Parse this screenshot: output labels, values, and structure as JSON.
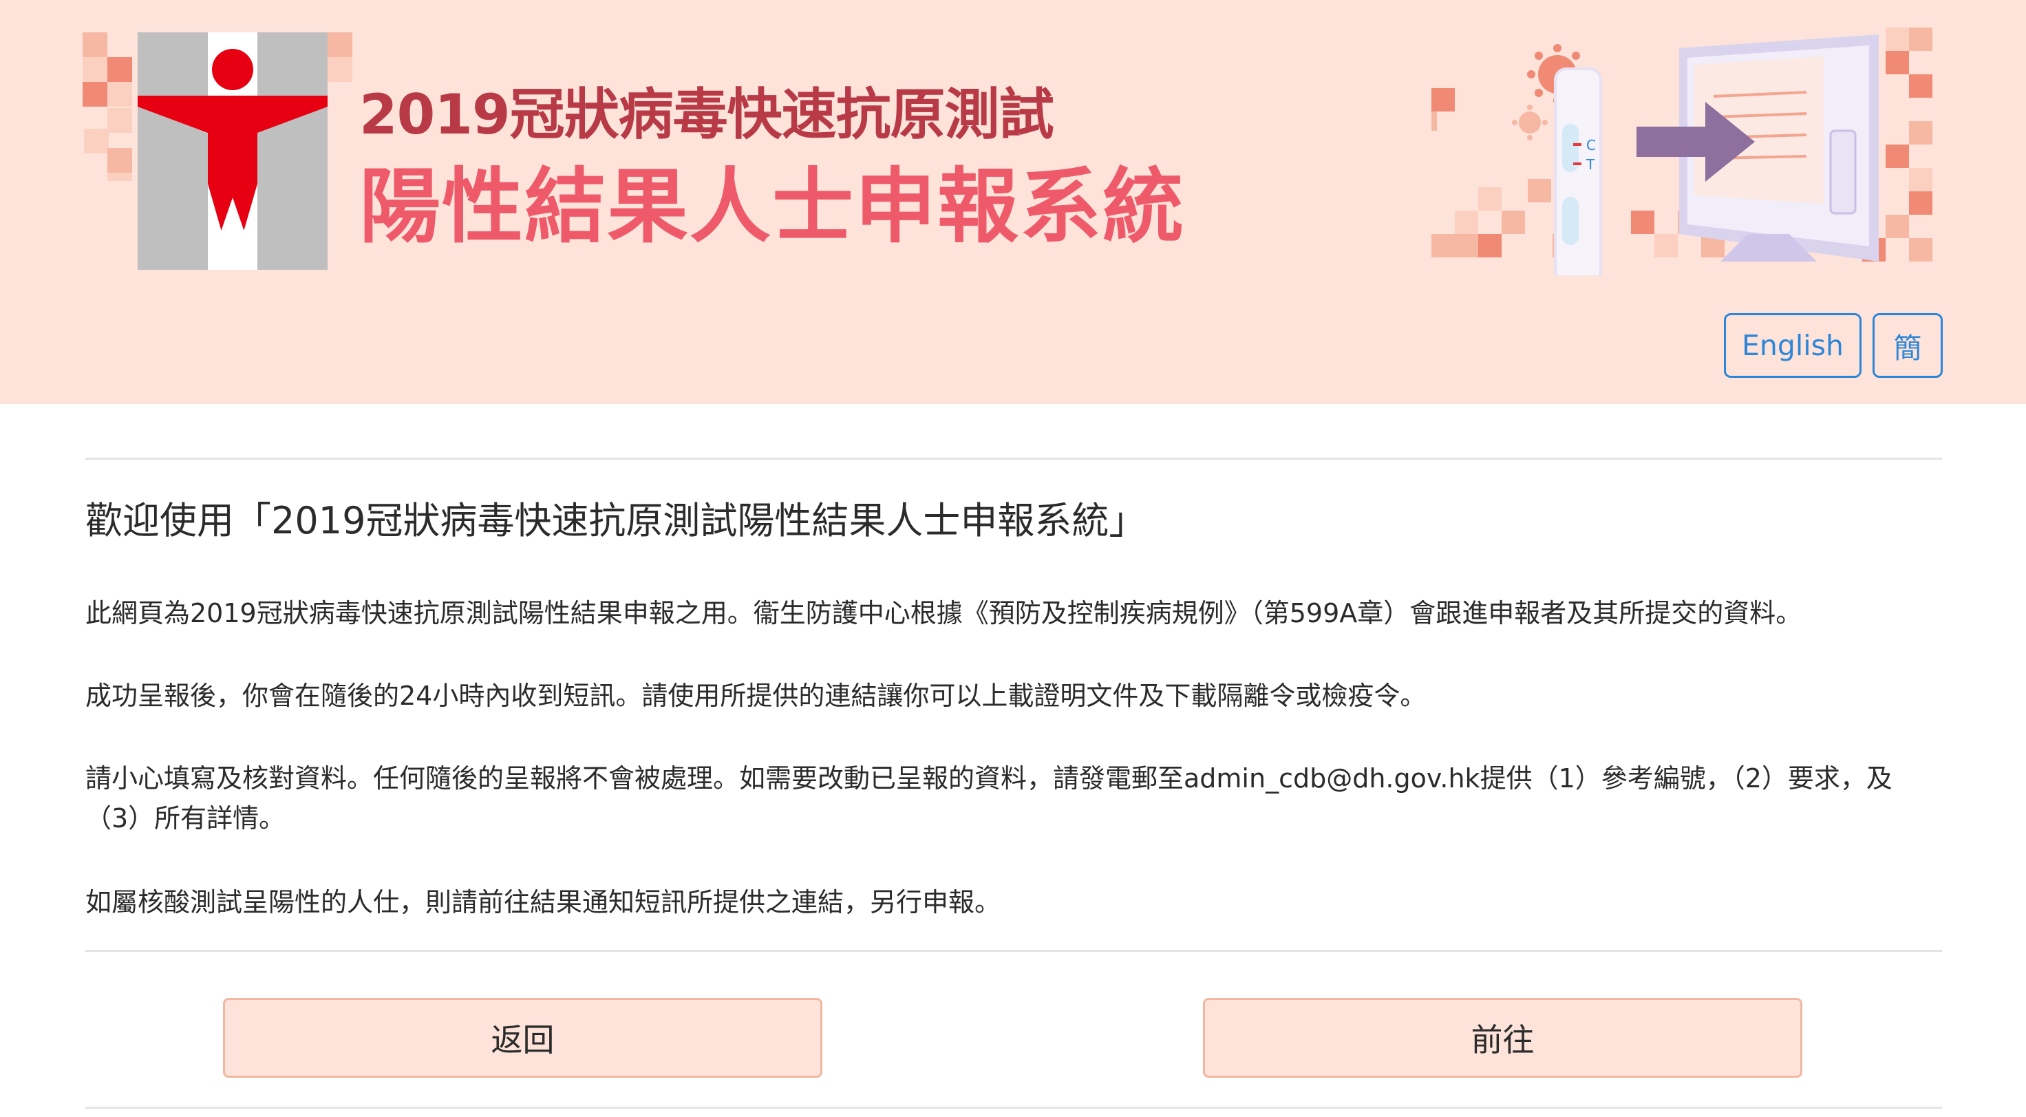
{
  "header": {
    "title_line1": "2019冠狀病毒快速抗原測試",
    "title_line2": "陽性結果人士申報系統",
    "logo_icon": "department-of-health-logo-icon",
    "illustration_icon": "rapid-test-to-computer-illustration-icon",
    "test_kit_labels": {
      "c": "C",
      "t": "T"
    },
    "language_buttons": {
      "english": "English",
      "simplified": "簡"
    }
  },
  "main": {
    "heading": "歡迎使用「2019冠狀病毒快速抗原測試陽性結果人士申報系統」",
    "paragraphs": [
      "此網頁為2019冠狀病毒快速抗原測試陽性結果申報之用。衞生防護中心根據《預防及控制疾病規例》（第599A章）會跟進申報者及其所提交的資料。",
      "成功呈報後，你會在隨後的24小時內收到短訊。請使用所提供的連結讓你可以上載證明文件及下載隔離令或檢疫令。",
      "請小心填寫及核對資料。任何隨後的呈報將不會被處理。如需要改動已呈報的資料，請發電郵至admin_cdb@dh.gov.hk提供（1）參考編號，（2）要求，及（3）所有詳情。",
      "如屬核酸測試呈陽性的人仕，則請前往結果通知短訊所提供之連結，另行申報。"
    ]
  },
  "actions": {
    "back": "返回",
    "next": "前往"
  },
  "colors": {
    "banner_bg": "#fde3d9",
    "title_dark": "#b83a46",
    "title_light": "#ef5a6a",
    "link_blue": "#2d86d8",
    "button_bg": "#fde3d9",
    "button_border": "#f0b8a2"
  }
}
